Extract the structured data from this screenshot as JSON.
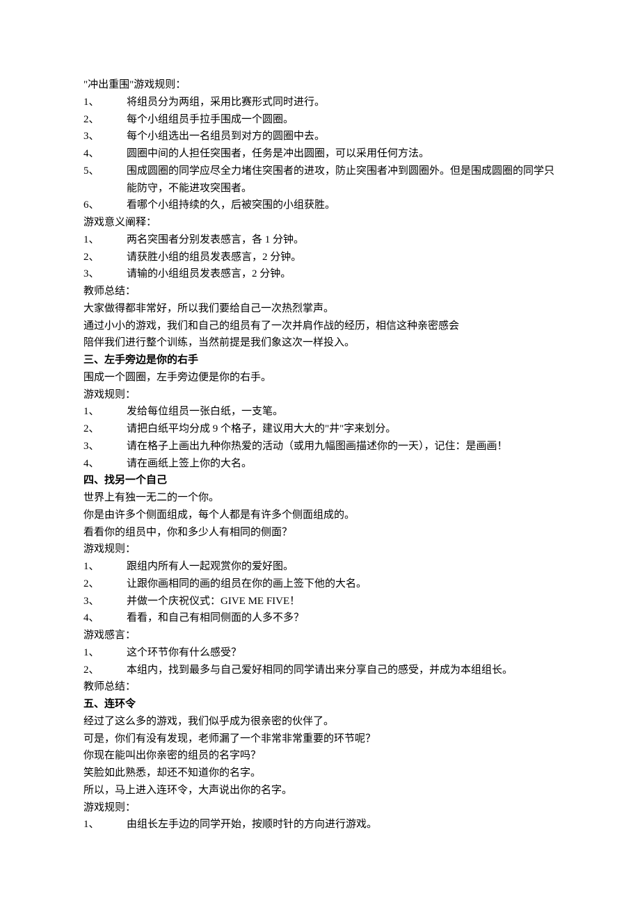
{
  "s1": {
    "title": "\"冲出重围\"游戏规则：",
    "r1n": "1、",
    "r1t": "将组员分为两组，采用比赛形式同时进行。",
    "r2n": "2、",
    "r2t": "每个小组组员手拉手围成一个圆圈。",
    "r3n": "3、",
    "r3t": "每个小组选出一名组员到对方的圆圈中去。",
    "r4n": "4、",
    "r4t": "圆圈中间的人担任突围者，任务是冲出圆圈，可以采用任何方法。",
    "r5n": "5、",
    "r5t": "围成圆圈的同学应尽全力堵住突围者的进攻，防止突围者冲到圆圈外。但是围成圆圈的同学只能防守，不能进攻突围者。",
    "r6n": "6、",
    "r6t": "看哪个小组持续的久，后被突围的小组获胜。"
  },
  "s2": {
    "title": "游戏意义阐释：",
    "r1n": "1、",
    "r1t": "两名突围者分别发表感言，各 1 分钟。",
    "r2n": "2、",
    "r2t": "请获胜小组的组员发表感言，2 分钟。",
    "r3n": "3、",
    "r3t": "请输的小组组员发表感言，2 分钟。"
  },
  "s3": {
    "title": "教师总结：",
    "p1": "大家做得都非常好，所以我们要给自己一次热烈掌声。",
    "p2": "通过小小的游戏，我们和自己的组员有了一次并肩作战的经历，相信这种亲密感会",
    "p3": "陪伴我们进行整个训练，当然前提是我们象这次一样投入。"
  },
  "s4": {
    "heading": "三、左手旁边是你的右手",
    "p1": "围成一个圆圈，左手旁边便是你的右手。",
    "rulesTitle": "游戏规则：",
    "r1n": "1、",
    "r1t": "发给每位组员一张白纸，一支笔。",
    "r2n": "2、",
    "r2t": "请把白纸平均分成 9 个格子，建议用大大的\"井\"字来划分。",
    "r3n": "3、",
    "r3t": "请在格子上画出九种你热爱的活动（或用九幅图画描述你的一天），记住：是画画！",
    "r4n": "4、",
    "r4t": "请在画纸上签上你的大名。"
  },
  "s5": {
    "heading": "四、找另一个自己",
    "p1": "世界上有独一无二的一个你。",
    "p2": "你是由许多个侧面组成，每个人都是有许多个侧面组成的。",
    "p3": "看看你的组员中，你和多少人有相同的侧面？",
    "rulesTitle": "游戏规则：",
    "r1n": "1、",
    "r1t": "跟组内所有人一起观赏你的爱好图。",
    "r2n": "2、",
    "r2t": "让跟你画相同的画的组员在你的画上签下他的大名。",
    "r3n": "3、",
    "r3t": "并做一个庆祝仪式：GIVE ME FIVE！",
    "r4n": "4、",
    "r4t": "看看，和自己有相同侧面的人多不多？"
  },
  "s6": {
    "title": "游戏感言：",
    "r1n": "1、",
    "r1t": "这个环节你有什么感受？",
    "r2n": "2、",
    "r2t": "本组内，找到最多与自己爱好相同的同学请出来分享自己的感受，并成为本组组长。",
    "summary": "教师总结："
  },
  "s7": {
    "heading": "五、连环令",
    "p1": "经过了这么多的游戏，我们似乎成为很亲密的伙伴了。",
    "p2": "可是，你们有没有发现，老师漏了一个非常非常重要的环节呢？",
    "p3": "你现在能叫出你亲密的组员的名字吗？",
    "p4": "笑脸如此熟悉，却还不知道你的名字。",
    "p5": "所以，马上进入连环令，大声说出你的名字。",
    "rulesTitle": "游戏规则：",
    "r1n": "1、",
    "r1t": "由组长左手边的同学开始，按顺时针的方向进行游戏。"
  }
}
